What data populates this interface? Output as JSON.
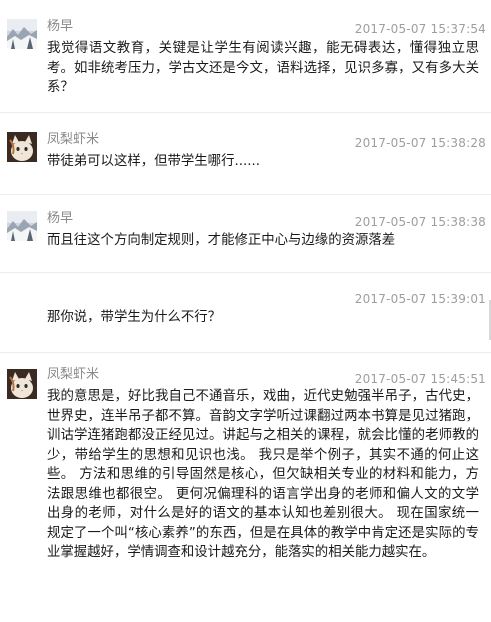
{
  "messages": [
    {
      "user": "杨早",
      "avatar": "snow-landscape-avatar",
      "timestamp": "2017-05-07 15:37:54",
      "text": "我觉得语文教育，关键是让学生有阅读兴趣，能无碍表达，懂得独立思考。如非统考压力，学古文还是今文，语料选择，见识多寡，又有多大关系？"
    },
    {
      "user": "凤梨虾米",
      "avatar": "cat-avatar",
      "timestamp": "2017-05-07 15:38:28",
      "text": "带徒弟可以这样，但带学生哪行......"
    },
    {
      "user": "杨早",
      "avatar": "snow-landscape-avatar",
      "timestamp": "2017-05-07 15:38:38",
      "text": "而且往这个方向制定规则，才能修正中心与边缘的资源落差"
    },
    {
      "user": "",
      "avatar": "",
      "timestamp": "2017-05-07 15:39:01",
      "text": "那你说，带学生为什么不行？"
    },
    {
      "user": "凤梨虾米",
      "avatar": "cat-avatar",
      "timestamp": "2017-05-07 15:45:51",
      "text": "我的意思是，好比我自己不通音乐，戏曲，近代史勉强半吊子，古代史，世界史，连半吊子都不算。音韵文字学听过课翻过两本书算是见过猪跑，训诂学连猪跑都没正经见过。讲起与之相关的课程，就会比懂的老师教的少，带给学生的思想和见识也浅。 我只是举个例子，其实不通的何止这些。 方法和思维的引导固然是核心，但欠缺相关专业的材料和能力，方法跟思维也都很空。 更何况偏理科的语言学出身的老师和偏人文的文学出身的老师，对什么是好的语文的基本认知也差别很大。 现在国家统一规定了一个叫“核心素养”的东西，但是在具体的教学中肯定还是实际的专业掌握越好，学情调查和设计越充分，能落实的相关能力越实在。"
    }
  ]
}
